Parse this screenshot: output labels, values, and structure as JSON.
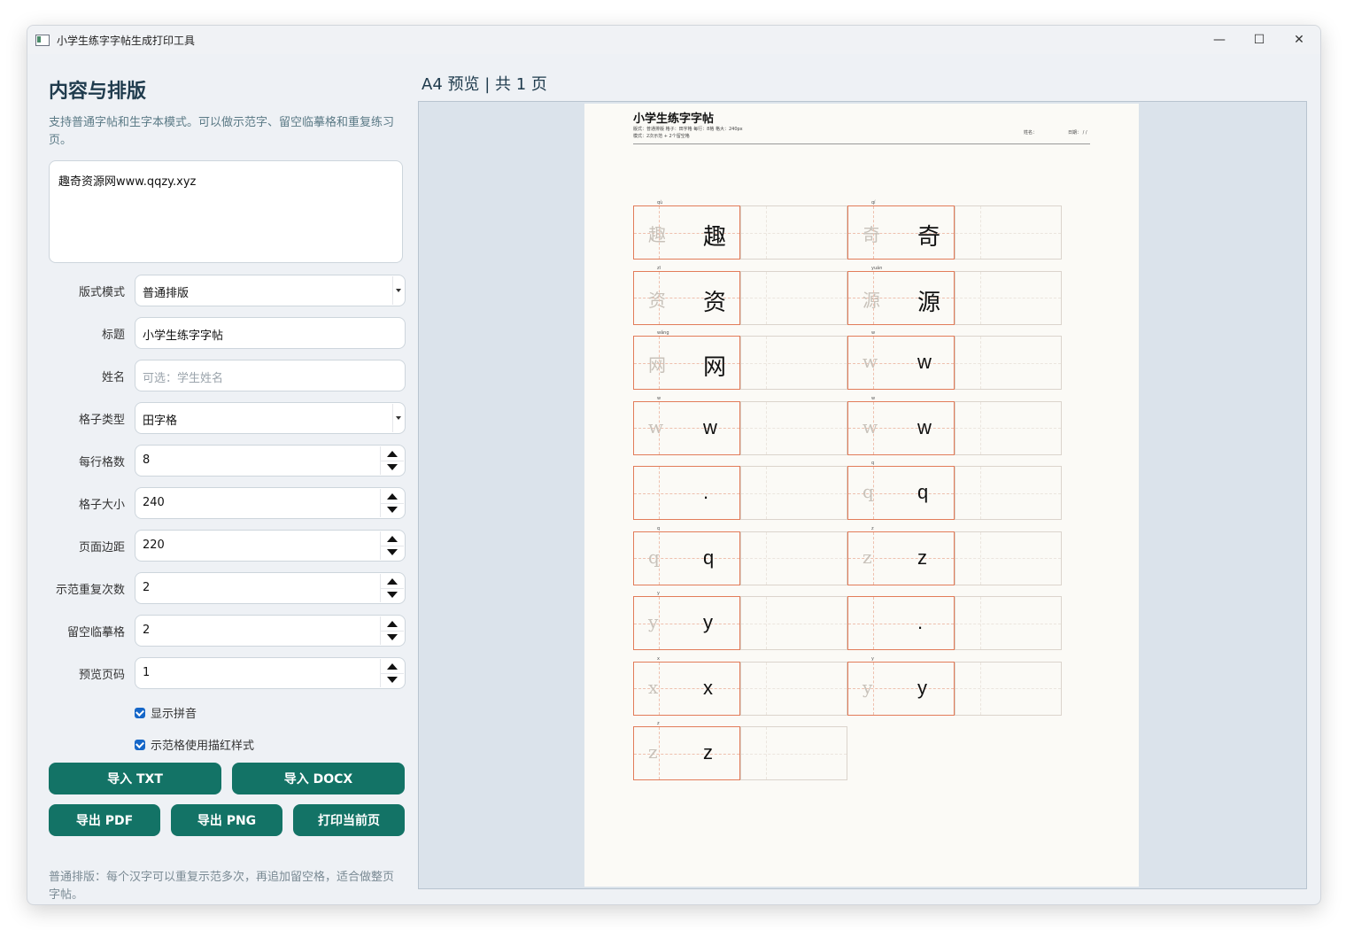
{
  "window": {
    "title": "小学生练字字帖生成打印工具",
    "controls": [
      "—",
      "☐",
      "✕"
    ]
  },
  "left": {
    "heading": "内容与排版",
    "description": "支持普通字帖和生字本模式。可以做示范字、留空临摹格和重复练习页。",
    "content_text": "趣奇资源网www.qqzy.xyz",
    "fields": {
      "layout_mode": {
        "label": "版式模式",
        "value": "普通排版"
      },
      "title": {
        "label": "标题",
        "value": "小学生练字字帖"
      },
      "name": {
        "label": "姓名",
        "placeholder": "可选：学生姓名"
      },
      "grid_type": {
        "label": "格子类型",
        "value": "田字格"
      },
      "per_row": {
        "label": "每行格数",
        "value": "8"
      },
      "cell_size": {
        "label": "格子大小",
        "value": "240"
      },
      "margin": {
        "label": "页面边距",
        "value": "220"
      },
      "demo_repeat": {
        "label": "示范重复次数",
        "value": "2"
      },
      "blank_cells": {
        "label": "留空临摹格",
        "value": "2"
      },
      "preview_page": {
        "label": "预览页码",
        "value": "1"
      }
    },
    "checks": {
      "show_pinyin": "显示拼音",
      "red_trace": "示范格使用描红样式"
    },
    "buttons": {
      "import_txt": "导入 TXT",
      "import_docx": "导入 DOCX",
      "export_pdf": "导出 PDF",
      "export_png": "导出 PNG",
      "print_page": "打印当前页"
    },
    "note": "普通排版：每个汉字可以重复示范多次，再追加留空格，适合做整页字帖。"
  },
  "preview": {
    "label": "A4 预览  |  共 1 页",
    "paper": {
      "title": "小学生练字字帖",
      "meta_line1": "版式：普通排版   格子：田字格   每行：8格   格大：240px",
      "meta_line2": "模式：2次示范 + 2个留空格",
      "right_name": "姓名：",
      "right_date": "日期：  /  /"
    },
    "cells": [
      {
        "char": "趣",
        "pinyin": "qù"
      },
      {
        "char": "奇",
        "pinyin": "qí"
      },
      {
        "char": "资",
        "pinyin": "zī"
      },
      {
        "char": "源",
        "pinyin": "yuán"
      },
      {
        "char": "网",
        "pinyin": "wǎng"
      },
      {
        "char": "w",
        "pinyin": "w"
      },
      {
        "char": "w",
        "pinyin": "w"
      },
      {
        "char": "w",
        "pinyin": "w"
      },
      {
        "char": ".",
        "pinyin": ""
      },
      {
        "char": "q",
        "pinyin": "q"
      },
      {
        "char": "q",
        "pinyin": "q"
      },
      {
        "char": "z",
        "pinyin": "z"
      },
      {
        "char": "y",
        "pinyin": "y"
      },
      {
        "char": ".",
        "pinyin": ""
      },
      {
        "char": "x",
        "pinyin": "x"
      },
      {
        "char": "y",
        "pinyin": "y"
      },
      {
        "char": "z",
        "pinyin": "z"
      }
    ]
  }
}
